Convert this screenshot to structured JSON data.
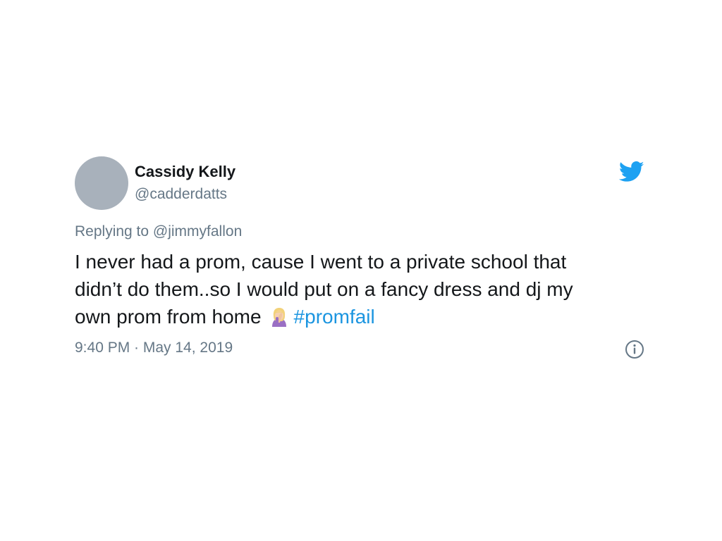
{
  "user": {
    "display_name": "Cassidy Kelly",
    "handle": "@cadderdatts"
  },
  "reply": {
    "prefix": "Replying to",
    "mention": "@jimmyfallon"
  },
  "tweet": {
    "line1": "I never had a prom, cause I went to a private school that",
    "line2": "didn’t do them..so I would put on a fancy dress and dj my",
    "line3": "own prom from home",
    "emoji": "woman-facepalming-emoji",
    "hashtag": "#promfail"
  },
  "meta": {
    "timestamp": "9:40 PM · May 14, 2019"
  },
  "icons": {
    "brand": "twitter-bird-icon",
    "info": "info-icon"
  },
  "colors": {
    "text": "#14171a",
    "secondary": "#657786",
    "link": "#1b95e0",
    "brand": "#1da1f2",
    "avatar": "#a8b1bb"
  }
}
